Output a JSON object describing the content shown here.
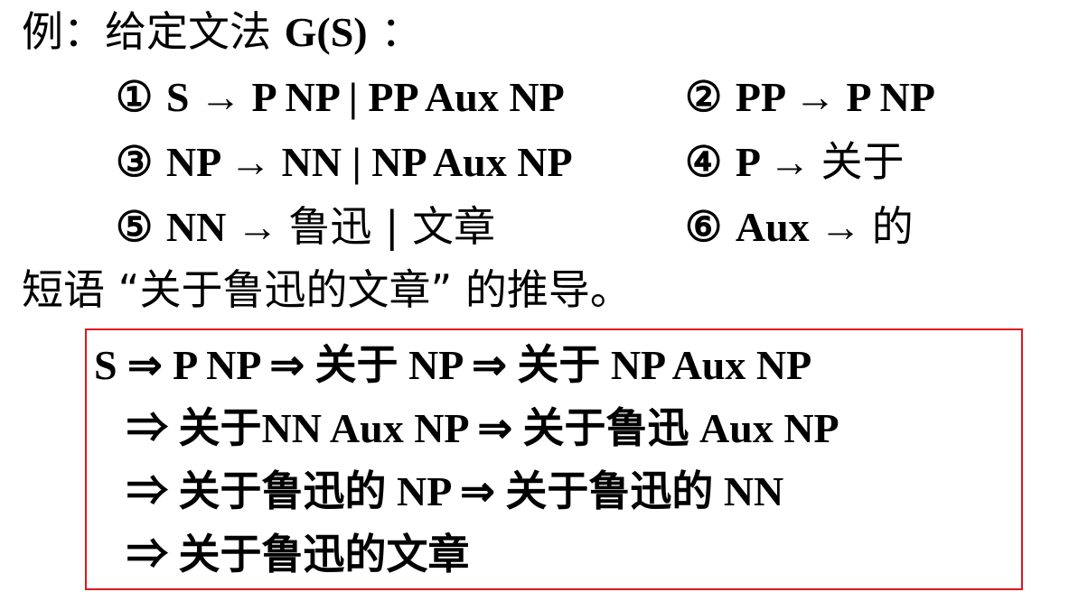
{
  "title": {
    "lead": "例：给定文法",
    "grammar": "G(S)",
    "colon": "："
  },
  "rules": [
    {
      "num": "①",
      "text": "S → P NP | PP Aux NP",
      "cjk": ""
    },
    {
      "num": "②",
      "text": "PP → P  NP",
      "cjk": ""
    },
    {
      "num": "③",
      "text": "NP → NN | NP Aux NP",
      "cjk": ""
    },
    {
      "num": "④",
      "text": "P → ",
      "cjk": "关于"
    },
    {
      "num": "⑤",
      "text": "NN → ",
      "cjk": "鲁迅 | 文章"
    },
    {
      "num": "⑥",
      "text": "Aux → ",
      "cjk": "的"
    }
  ],
  "question": "短语 “关于鲁迅的文章” 的推导。",
  "derivation": [
    "S ⇒ P NP ⇒ 关于 NP ⇒ 关于 NP Aux NP",
    "⇒ 关于NN Aux NP ⇒ 关于鲁迅 Aux NP",
    "⇒ 关于鲁迅的 NP ⇒ 关于鲁迅的 NN",
    "⇒ 关于鲁迅的文章"
  ],
  "colors": {
    "text": "#000000",
    "box_border": "#e0161c"
  }
}
